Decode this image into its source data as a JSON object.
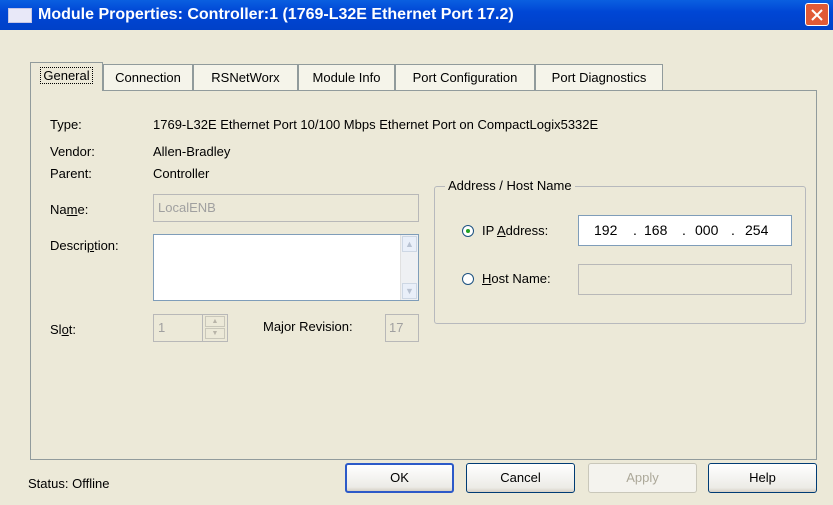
{
  "window": {
    "title": "Module Properties: Controller:1 (1769-L32E Ethernet Port 17.2)"
  },
  "tabs": [
    "General",
    "Connection",
    "RSNetWorx",
    "Module Info",
    "Port Configuration",
    "Port Diagnostics"
  ],
  "general": {
    "type_label": "Type:",
    "type_value": "1769-L32E Ethernet Port 10/100 Mbps Ethernet Port on CompactLogix5332E",
    "vendor_label": "Vendor:",
    "vendor_value": "Allen-Bradley",
    "parent_label": "Parent:",
    "parent_value": "Controller",
    "name_label_pre": "Na",
    "name_label_u": "m",
    "name_label_post": "e:",
    "name_value": "LocalENB",
    "description_label_pre": "Descri",
    "description_label_u": "p",
    "description_label_post": "tion:",
    "description_value": "",
    "slot_label_pre": "Sl",
    "slot_label_u": "o",
    "slot_label_post": "t:",
    "slot_value": "1",
    "major_revision_label": "Major Revision:",
    "major_revision_value": "17"
  },
  "address": {
    "group_title": "Address / Host Name",
    "ip_label_pre": "IP ",
    "ip_label_u": "A",
    "ip_label_post": "ddress:",
    "ip_octets": [
      "192",
      "168",
      "000",
      "254"
    ],
    "ip_dot": ".",
    "ip_selected": true,
    "host_label_u": "H",
    "host_label_post": "ost Name:",
    "host_value": ""
  },
  "status": {
    "label": "Status:",
    "value": "Offline"
  },
  "buttons": {
    "ok": "OK",
    "cancel": "Cancel",
    "apply": "Apply",
    "help": "Help"
  },
  "colors": {
    "title_bar": "#0046d5",
    "close_button": "#e15a36",
    "dialog_bg": "#ece9d8"
  }
}
